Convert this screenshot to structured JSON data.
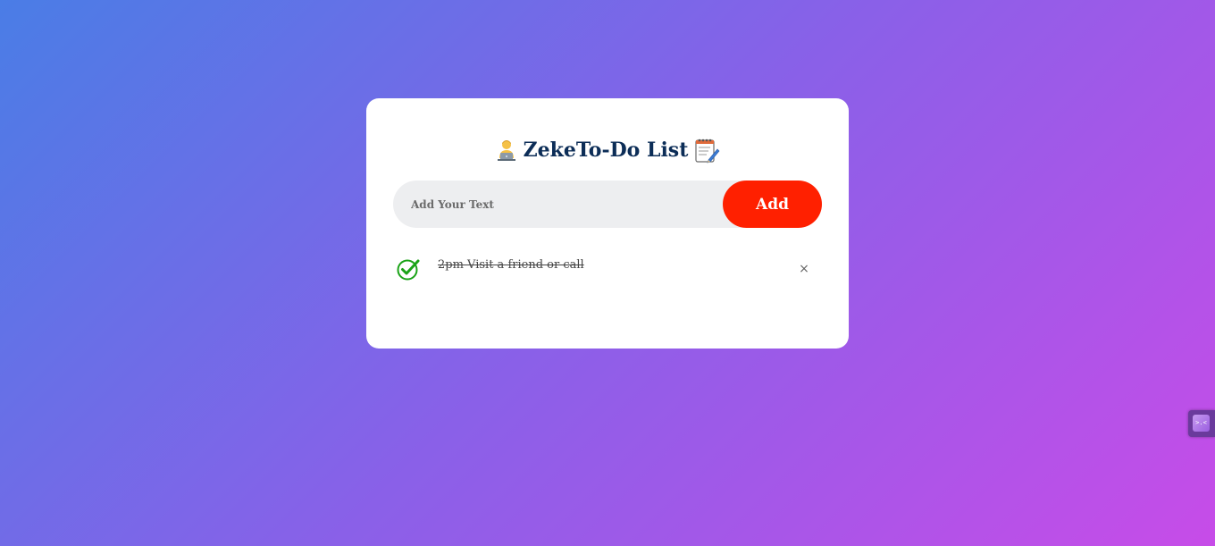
{
  "app": {
    "title": "ZekeTo-Do List",
    "title_icon_left": "person-at-laptop-icon",
    "title_icon_right": "notepad-pencil-icon"
  },
  "input": {
    "placeholder": "Add Your Text",
    "value": ""
  },
  "add_button": {
    "label": "Add"
  },
  "tasks": [
    {
      "text": "2pm Visit a friend or call",
      "completed": true,
      "check_icon": "check-circle-icon",
      "remove_symbol": "×"
    }
  ],
  "side_widget": {
    "icon": "extension-widget-icon"
  },
  "colors": {
    "title": "#0c2d57",
    "add_button": "#ff2000",
    "input_background": "#edeef0",
    "check": "#1aa317",
    "background_start": "#4a7de6",
    "background_end": "#c74ce8"
  }
}
